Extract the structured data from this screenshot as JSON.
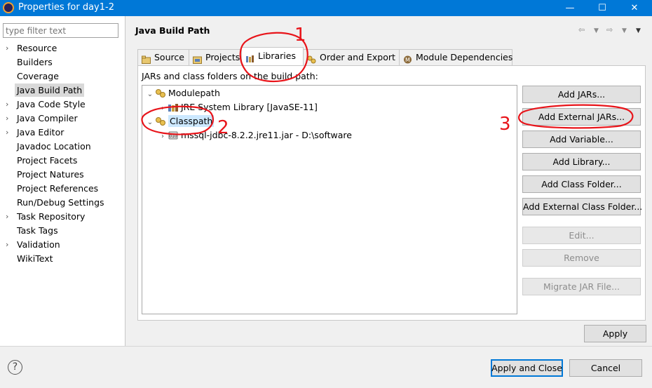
{
  "window": {
    "title": "Properties for day1-2",
    "minimize": "—",
    "maximize": "☐",
    "close": "✕"
  },
  "sidebar": {
    "filter_placeholder": "type filter text",
    "items": [
      {
        "label": "Resource",
        "expandable": true
      },
      {
        "label": "Builders",
        "expandable": false
      },
      {
        "label": "Coverage",
        "expandable": false
      },
      {
        "label": "Java Build Path",
        "expandable": false,
        "selected": true
      },
      {
        "label": "Java Code Style",
        "expandable": true
      },
      {
        "label": "Java Compiler",
        "expandable": true
      },
      {
        "label": "Java Editor",
        "expandable": true
      },
      {
        "label": "Javadoc Location",
        "expandable": false
      },
      {
        "label": "Project Facets",
        "expandable": false
      },
      {
        "label": "Project Natures",
        "expandable": false
      },
      {
        "label": "Project References",
        "expandable": false
      },
      {
        "label": "Run/Debug Settings",
        "expandable": false
      },
      {
        "label": "Task Repository",
        "expandable": true
      },
      {
        "label": "Task Tags",
        "expandable": false
      },
      {
        "label": "Validation",
        "expandable": true
      },
      {
        "label": "WikiText",
        "expandable": false
      }
    ]
  },
  "main": {
    "title": "Java Build Path",
    "tabs": [
      {
        "label": "Source",
        "icon": "source-folder-icon"
      },
      {
        "label": "Projects",
        "icon": "projects-icon"
      },
      {
        "label": "Libraries",
        "icon": "libraries-icon",
        "active": true
      },
      {
        "label": "Order and Export",
        "icon": "order-export-icon"
      },
      {
        "label": "Module Dependencies",
        "icon": "module-icon"
      }
    ],
    "subtitle": "JARs and class folders on the build path:",
    "tree": {
      "modulepath": "Modulepath",
      "jre": "JRE System Library [JavaSE-11]",
      "classpath": "Classpath",
      "jar": "mssql-jdbc-8.2.2.jre11.jar - D:\\software"
    },
    "buttons": [
      {
        "label": "Add JARs...",
        "enabled": true
      },
      {
        "label": "Add External JARs...",
        "enabled": true
      },
      {
        "label": "Add Variable...",
        "enabled": true
      },
      {
        "label": "Add Library...",
        "enabled": true
      },
      {
        "label": "Add Class Folder...",
        "enabled": true
      },
      {
        "label": "Add External Class Folder...",
        "enabled": true
      },
      {
        "label": "Edit...",
        "enabled": false
      },
      {
        "label": "Remove",
        "enabled": false
      },
      {
        "label": "Migrate JAR File...",
        "enabled": false
      }
    ],
    "apply": "Apply"
  },
  "footer": {
    "help": "?",
    "apply_close": "Apply and Close",
    "cancel": "Cancel"
  },
  "annotations": {
    "marks": [
      "1",
      "2",
      "3"
    ],
    "color": "#e8141a"
  }
}
